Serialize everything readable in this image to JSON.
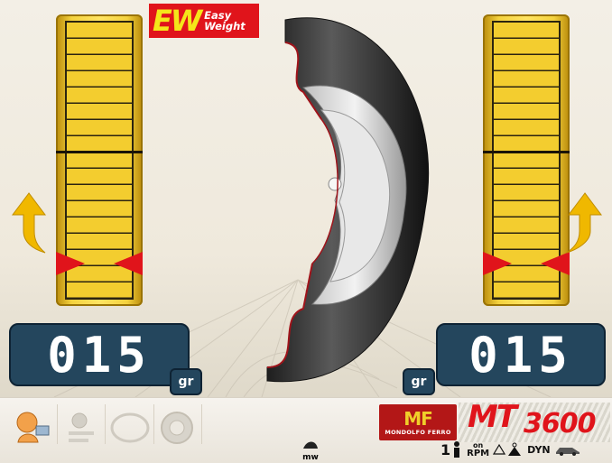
{
  "brand": {
    "easy_weight_mark": "EW",
    "easy_weight_line1": "Easy",
    "easy_weight_line2": "Weight",
    "manufacturer_mark": "MF",
    "manufacturer_name": "MONDOLFO FERRO",
    "model_prefix": "MT",
    "model_number": "3600"
  },
  "left_plane": {
    "weight_value": "015",
    "unit": "gr",
    "direction": "up",
    "position_level": 0.13
  },
  "right_plane": {
    "weight_value": "015",
    "unit": "gr",
    "direction": "up",
    "position_level": 0.13
  },
  "toolbar": {
    "items": [
      {
        "name": "operator-settings",
        "icon": "operator-icon",
        "active": true
      },
      {
        "name": "weight-mode",
        "icon": "weight-mode-icon",
        "active": false
      },
      {
        "name": "wheel-profile",
        "icon": "wheel-outline-icon",
        "active": false
      },
      {
        "name": "wheel-rim",
        "icon": "wheel-rim-icon",
        "active": false
      }
    ],
    "center_badge": "mw"
  },
  "status": {
    "operator_number": "1",
    "rpm_state": "on",
    "rpm_label": "RPM",
    "mode": "DYN"
  },
  "colors": {
    "accent_red": "#e0141b",
    "gauge_yellow": "#f4d23e",
    "display_blue": "#24465d",
    "arrow_yellow": "#f0b800"
  }
}
